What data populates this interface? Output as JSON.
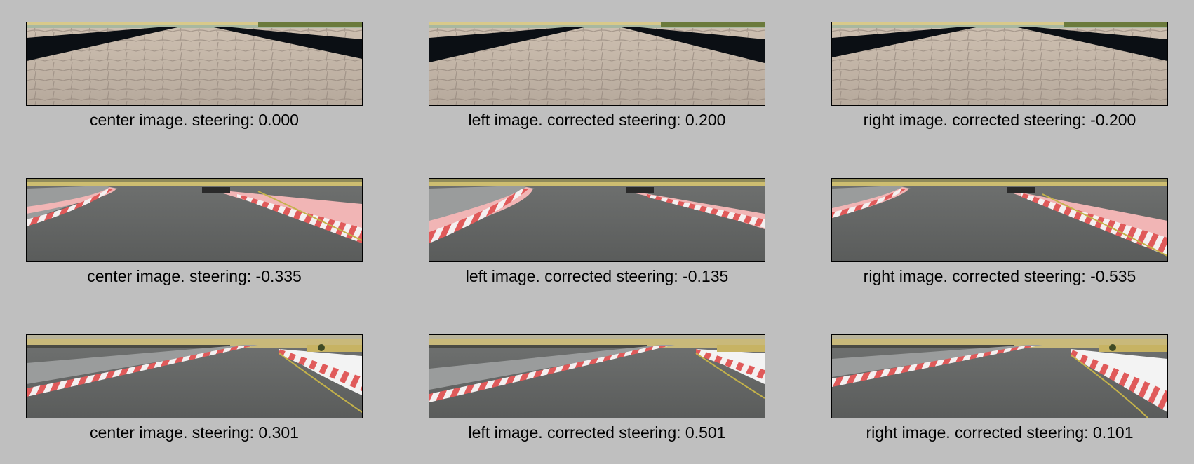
{
  "figure": {
    "rows": [
      {
        "scene": "cobblestone-road",
        "panels": [
          {
            "caption": "center image. steering: 0.000"
          },
          {
            "caption": "left image. corrected steering: 0.200"
          },
          {
            "caption": "right image. corrected steering: -0.200"
          }
        ]
      },
      {
        "scene": "track-curve-left",
        "panels": [
          {
            "caption": "center image. steering: -0.335"
          },
          {
            "caption": "left image. corrected steering: -0.135"
          },
          {
            "caption": "right image. corrected steering: -0.535"
          }
        ]
      },
      {
        "scene": "track-curve-right",
        "panels": [
          {
            "caption": "center image. steering: 0.301"
          },
          {
            "caption": "left image. corrected steering: 0.501"
          },
          {
            "caption": "right image. corrected steering: 0.101"
          }
        ]
      }
    ]
  }
}
